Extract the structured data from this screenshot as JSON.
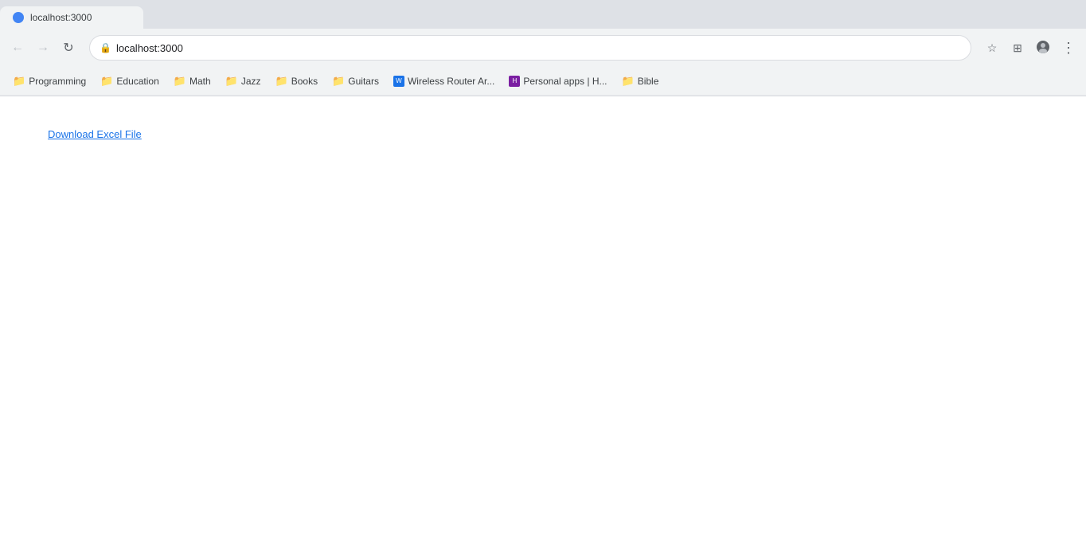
{
  "browser": {
    "tab": {
      "title": "localhost:3000"
    },
    "address": "localhost:3000",
    "address_full": "localhost:3000"
  },
  "bookmarks": {
    "items": [
      {
        "id": "programming",
        "label": "Programming",
        "type": "folder"
      },
      {
        "id": "education",
        "label": "Education",
        "type": "folder"
      },
      {
        "id": "math",
        "label": "Math",
        "type": "folder"
      },
      {
        "id": "jazz",
        "label": "Jazz",
        "type": "folder"
      },
      {
        "id": "books",
        "label": "Books",
        "type": "folder"
      },
      {
        "id": "guitars",
        "label": "Guitars",
        "type": "folder"
      },
      {
        "id": "wireless-router",
        "label": "Wireless Router Ar...",
        "type": "special-blue"
      },
      {
        "id": "personal-apps",
        "label": "Personal apps | H...",
        "type": "special-purple"
      },
      {
        "id": "bible",
        "label": "Bible",
        "type": "folder"
      }
    ]
  },
  "page": {
    "download_link_label": "Download Excel File"
  },
  "toolbar": {
    "back_label": "←",
    "forward_label": "→",
    "reload_label": "↻",
    "star_label": "☆",
    "extension_label": "⊞",
    "account_label": "⊙",
    "settings_label": "⋮"
  }
}
